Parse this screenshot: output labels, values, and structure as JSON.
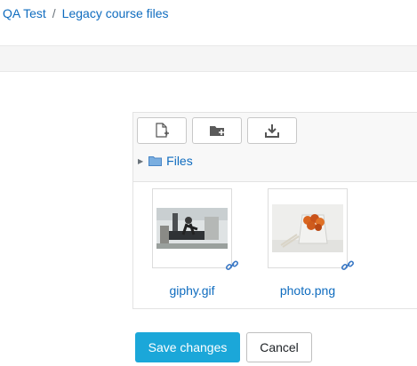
{
  "breadcrumb": {
    "items": [
      {
        "label": "QA Test"
      },
      {
        "label": "Legacy course files"
      }
    ],
    "separator": "/"
  },
  "filemanager": {
    "toolbar": [
      {
        "icon": "add-file-icon"
      },
      {
        "icon": "create-folder-icon"
      },
      {
        "icon": "download-icon"
      }
    ],
    "path": {
      "label": "Files",
      "icon": "folder-icon"
    },
    "files": [
      {
        "name": "giphy.gif",
        "thumbnail": "treadmill-photo",
        "badge_icon": "link-icon"
      },
      {
        "name": "photo.png",
        "thumbnail": "food-box-photo",
        "badge_icon": "link-icon"
      }
    ]
  },
  "actions": {
    "save_label": "Save changes",
    "cancel_label": "Cancel"
  },
  "colors": {
    "link": "#0f6cbf",
    "primary": "#1ba7d9"
  }
}
